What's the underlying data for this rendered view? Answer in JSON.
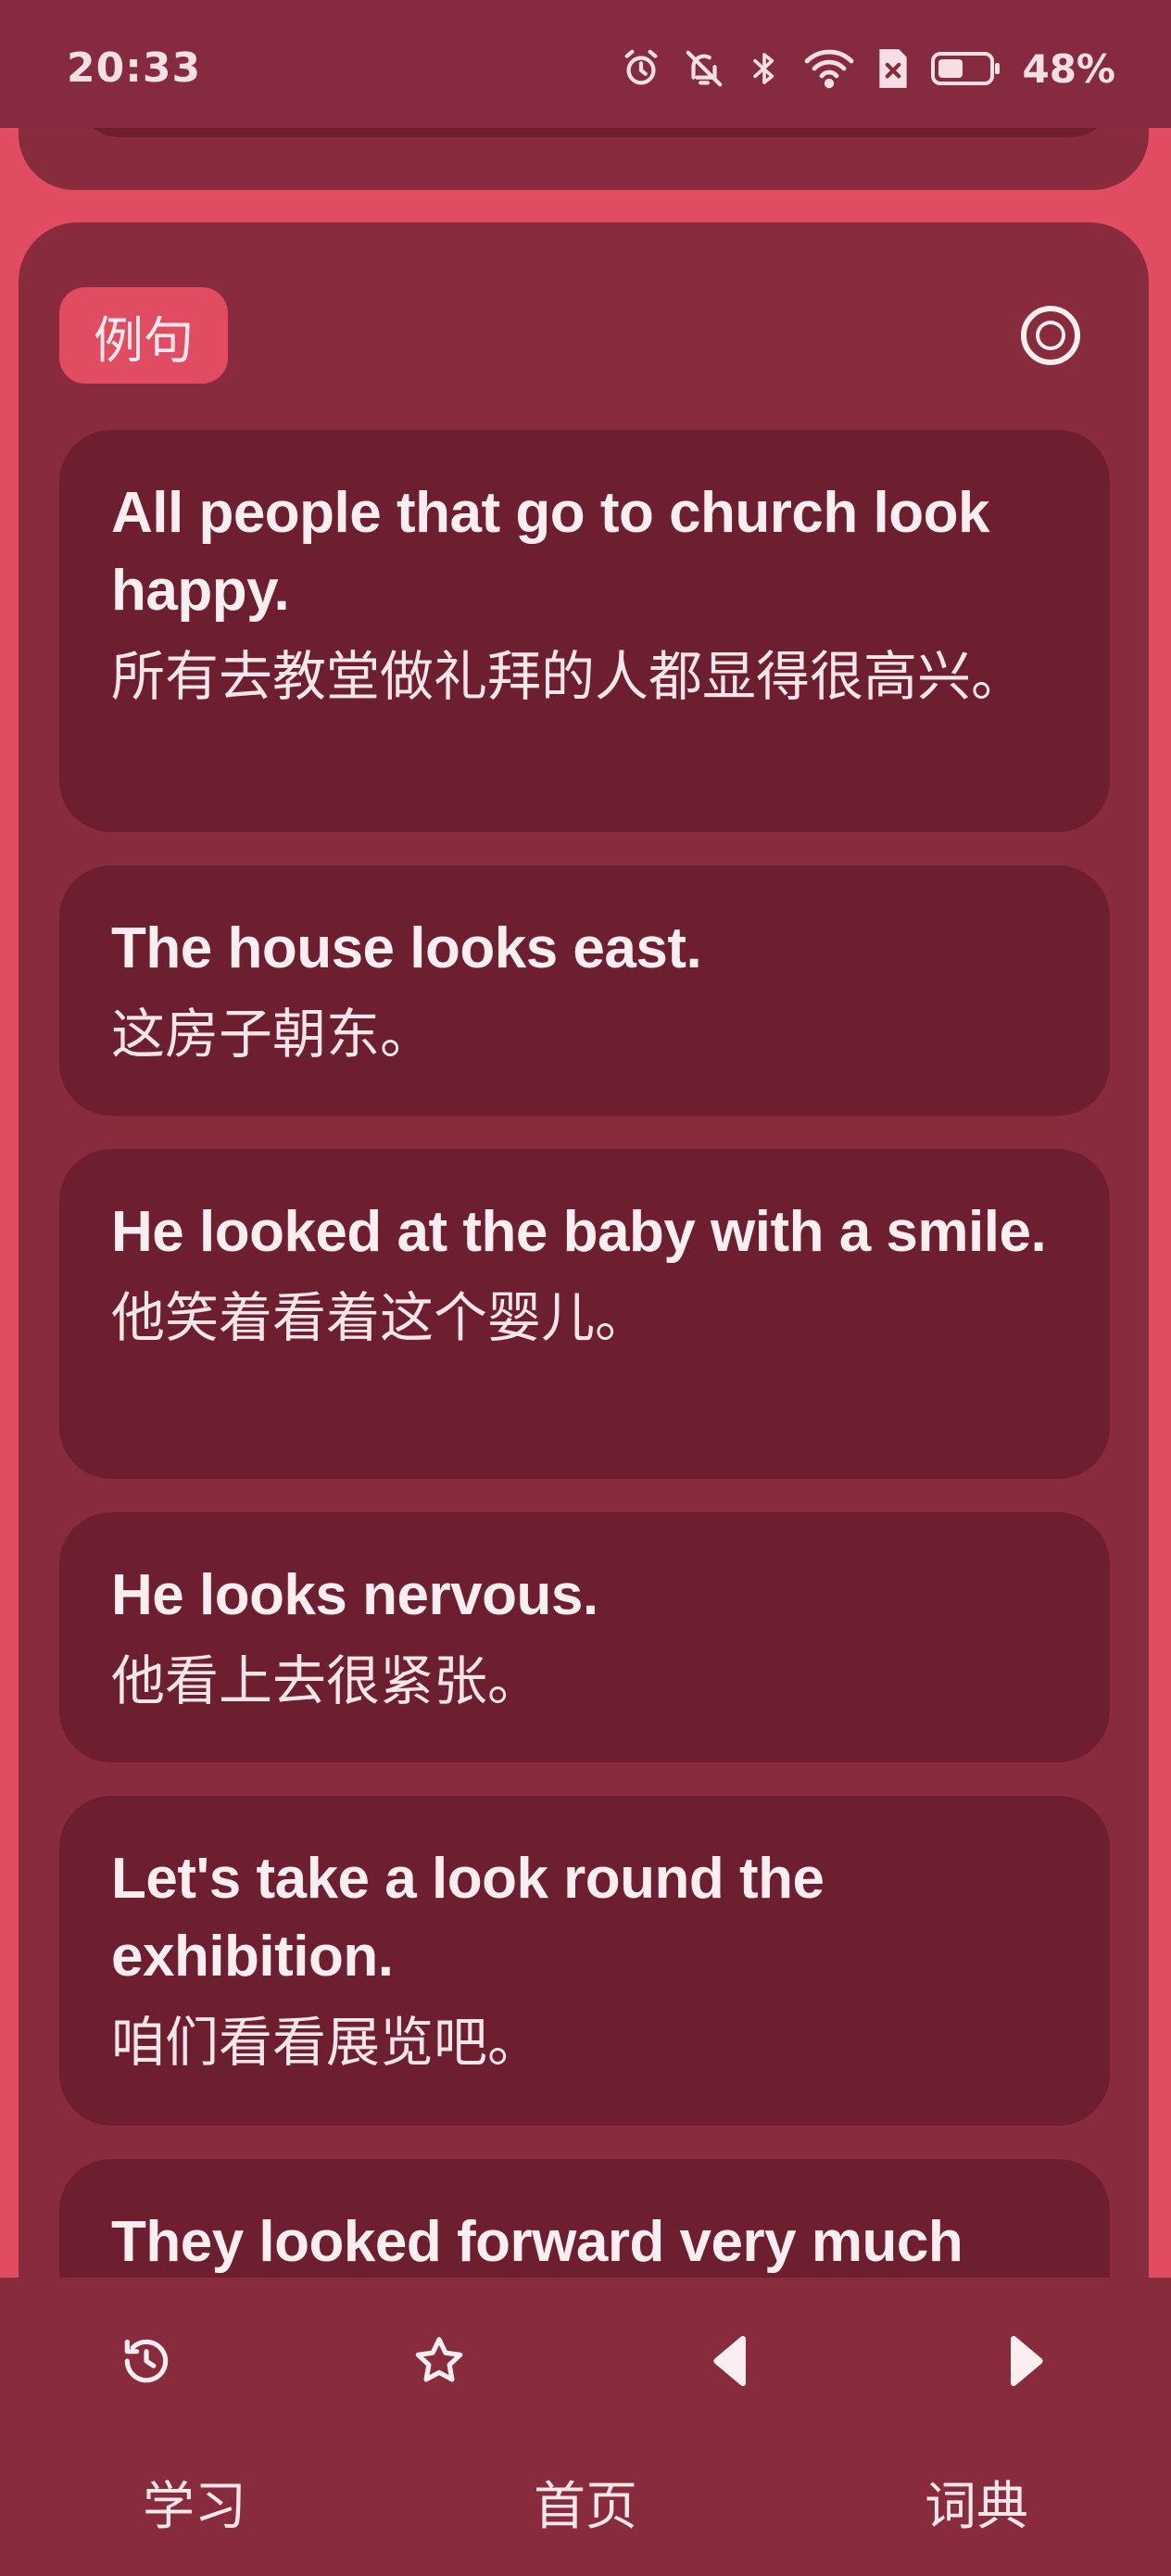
{
  "status_bar": {
    "time": "20:33",
    "battery": "48%",
    "icons": [
      "alarm-icon",
      "bell-off-icon",
      "bluetooth-icon",
      "wifi-icon",
      "no-sim-icon",
      "battery-icon"
    ]
  },
  "section": {
    "tag": "例句",
    "action_icon": "target-icon"
  },
  "examples": [
    {
      "en": "All people that go to church look happy.",
      "zh": "所有去教堂做礼拜的人都显得很高兴。"
    },
    {
      "en": "The house looks east.",
      "zh": "这房子朝东。"
    },
    {
      "en": "He looked at the baby with a smile.",
      "zh": "他笑着看着这个婴儿。"
    },
    {
      "en": "He looks nervous.",
      "zh": "他看上去很紧张。"
    },
    {
      "en": "Let's take a look round the exhibition.",
      "zh": "咱们看看展览吧。"
    },
    {
      "en": "They looked forward very much",
      "zh": ""
    }
  ],
  "toolbar": {
    "icons": [
      "history-icon",
      "star-icon",
      "previous-icon",
      "next-icon"
    ]
  },
  "bottom_nav": {
    "items": [
      "学习",
      "首页",
      "词典"
    ]
  },
  "colors": {
    "background": "#e24c62",
    "card": "#882b3d",
    "example_card": "#6d1f2f",
    "text": "#fbeef1"
  }
}
